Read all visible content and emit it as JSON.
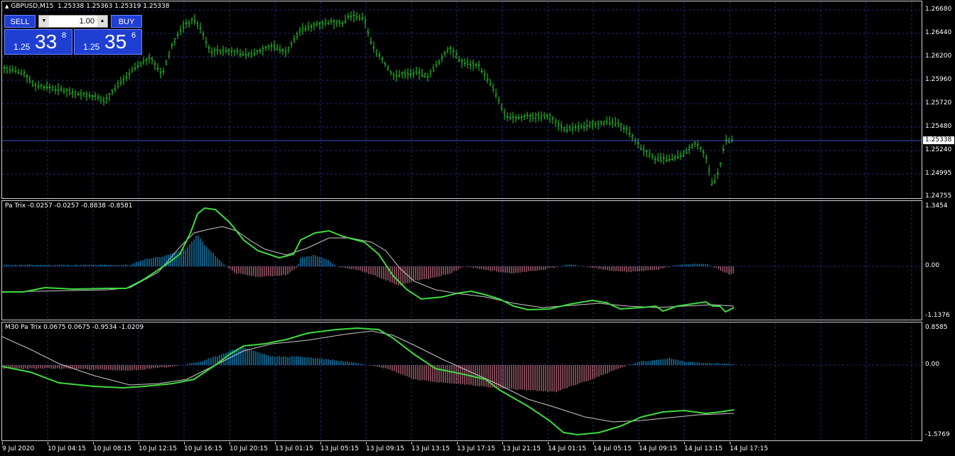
{
  "chart": {
    "symbol_title": "GBPUSD,M15",
    "ohlc": "1.25338 1.25363 1.25319 1.25338",
    "current_price": "1.25338"
  },
  "trade_panel": {
    "sell_label": "SELL",
    "buy_label": "BUY",
    "lot_value": "1.00",
    "sell_price": {
      "prefix": "1.25",
      "big": "33",
      "sup": "8"
    },
    "buy_price": {
      "prefix": "1.25",
      "big": "35",
      "sup": "6"
    }
  },
  "main_scale": [
    "1.26680",
    "1.26440",
    "1.26200",
    "1.25960",
    "1.25720",
    "1.25480",
    "1.25240",
    "1.24995",
    "1.24755"
  ],
  "indicator1": {
    "title": "Pa Trix -0.0257 -0.0257 -0.8838 -0.8581",
    "scale": [
      "1.3454",
      "0.00",
      "-1.1376"
    ]
  },
  "indicator2": {
    "title": "M30 Pa Trix 0.0675 0.0675 -0.9534 -1.0209",
    "scale": [
      "0.8585",
      "0.00",
      "-1.5769"
    ]
  },
  "time_labels": [
    "9 Jul 2020",
    "10 Jul 04:15",
    "10 Jul 08:15",
    "10 Jul 12:15",
    "10 Jul 16:15",
    "10 Jul 20:15",
    "13 Jul 01:15",
    "13 Jul 05:15",
    "13 Jul 09:15",
    "13 Jul 13:15",
    "13 Jul 17:15",
    "13 Jul 21:15",
    "14 Jul 01:15",
    "14 Jul 05:15",
    "14 Jul 09:15",
    "14 Jul 13:15",
    "14 Jul 17:15"
  ],
  "colors": {
    "bars": "#2fd12f",
    "signal": "#3ddb3d",
    "trix": "#c8c8c8",
    "hist_pos": "#1fb3ff",
    "hist_neg": "#f08aa0",
    "grid": "#1c2a78",
    "panel": "#1f3fd3"
  },
  "icons": {
    "collapse": "triangle-up-icon",
    "lot_down": "arrow-down-icon",
    "lot_up": "arrow-up-icon"
  }
}
